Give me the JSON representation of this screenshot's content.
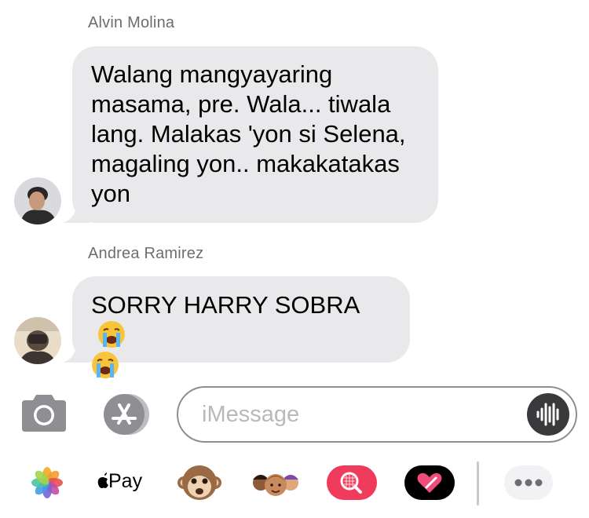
{
  "messages": [
    {
      "sender": "Alvin Molina",
      "text": "Walang mangyayaring masama, pre. Wala... tiwala lang. Malakas 'yon si Selena, magaling yon.. makakatakas yon",
      "lines": [
        "Walang mangyayaring",
        "masama, pre. Wala... tiwala",
        "lang. Malakas 'yon si Selena,",
        "magaling yon.. makakatakas",
        "yon"
      ]
    },
    {
      "sender": "Andrea Ramirez",
      "text": "SORRY HARRY SOBRA 😭 😭",
      "line1": "SORRY HARRY SOBRA",
      "emoji": "loudly-crying-face"
    }
  ],
  "composer": {
    "placeholder": "iMessage",
    "camera_icon": "camera-icon",
    "appstore_icon": "app-store-icon",
    "audio_icon": "audio-waveform-icon"
  },
  "app_drawer": {
    "items": [
      "photos-icon",
      "apple-pay-icon",
      "monkey-animoji-icon",
      "memoji-icon",
      "search-images-icon",
      "digital-touch-icon",
      "more-icon"
    ],
    "apple_pay_label": "Pay"
  },
  "colors": {
    "bubble_received": "#e9e9eb",
    "sender_name": "#6d6d72",
    "placeholder": "#b8b8bd",
    "icon_gray": "#8e8e93"
  }
}
